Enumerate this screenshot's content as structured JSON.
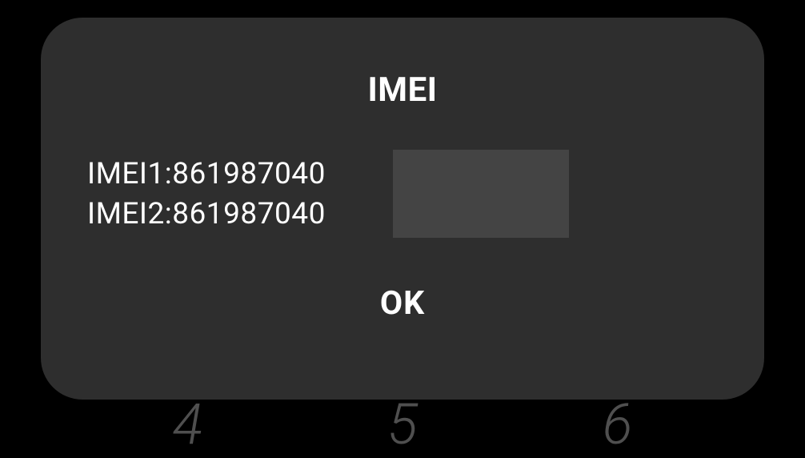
{
  "dialog": {
    "title": "IMEI",
    "imei1_label": "IMEI1:",
    "imei1_value": "861987040",
    "imei2_label": "IMEI2:",
    "imei2_value": "861987040",
    "ok_label": "OK"
  },
  "keypad": {
    "d1": "4",
    "d2": "5",
    "d3": "6"
  }
}
